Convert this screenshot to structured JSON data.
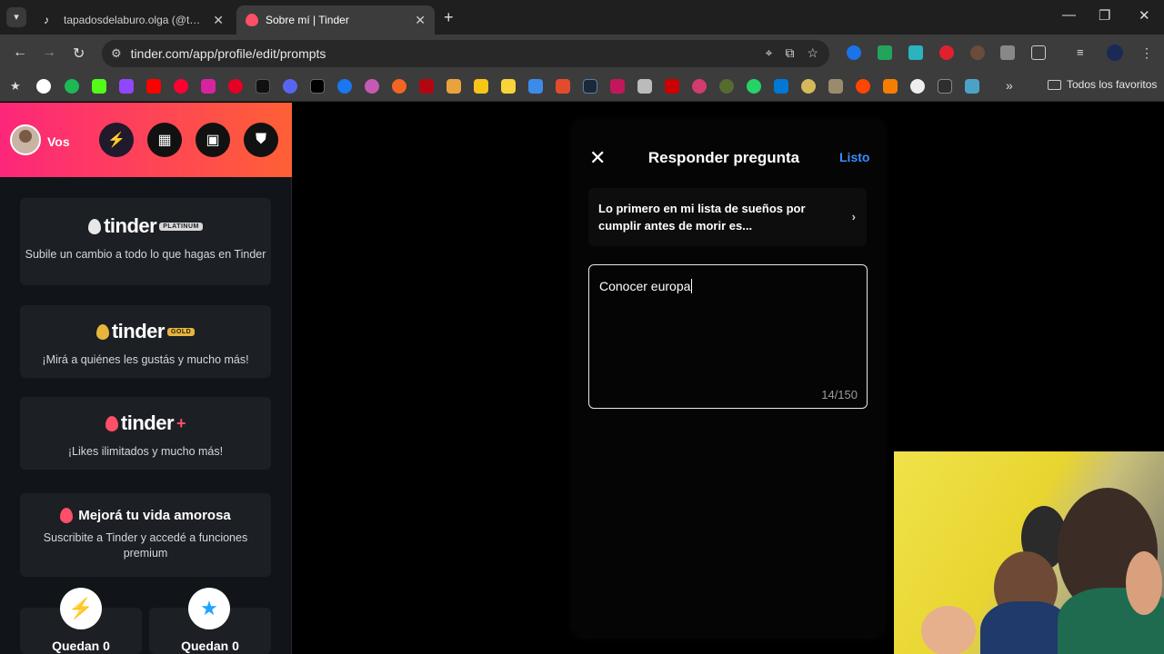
{
  "browser": {
    "tabs": [
      {
        "title": "tapadosdelaburo.olga (@tapad",
        "favicon": "tiktok-icon"
      },
      {
        "title": "Sobre mí | Tinder",
        "favicon": "tinder-flame-icon",
        "active": true
      }
    ],
    "url": "tinder.com/app/profile/edit/prompts",
    "bookmarks_folder": "Todos los favoritos"
  },
  "sidebar": {
    "user_name": "Vos",
    "cards": {
      "platinum": {
        "brand": "tinder",
        "badge": "PLATINUM",
        "desc": "Subile un cambio a todo lo que hagas en Tinder"
      },
      "gold": {
        "brand": "tinder",
        "badge": "GOLD",
        "desc": "¡Mirá a quiénes les gustás y mucho más!"
      },
      "plus": {
        "brand": "tinder",
        "badge": "+",
        "desc": "¡Likes ilimitados y mucho más!"
      },
      "promo": {
        "title": "Mejorá tu vida amorosa",
        "desc": "Suscribite a Tinder y accedé a funciones premium"
      }
    },
    "boosts_left": "Quedan 0",
    "super_likes_left": "Quedan 0"
  },
  "modal": {
    "title": "Responder pregunta",
    "done_label": "Listo",
    "prompt": "Lo primero en mi lista de sueños por cumplir antes de morir es...",
    "answer": "Conocer europa",
    "char_count": "14/150"
  },
  "colors": {
    "tinder_gradient_start": "#fd267a",
    "tinder_gradient_end": "#ff6036",
    "done_link": "#3a8cff"
  }
}
